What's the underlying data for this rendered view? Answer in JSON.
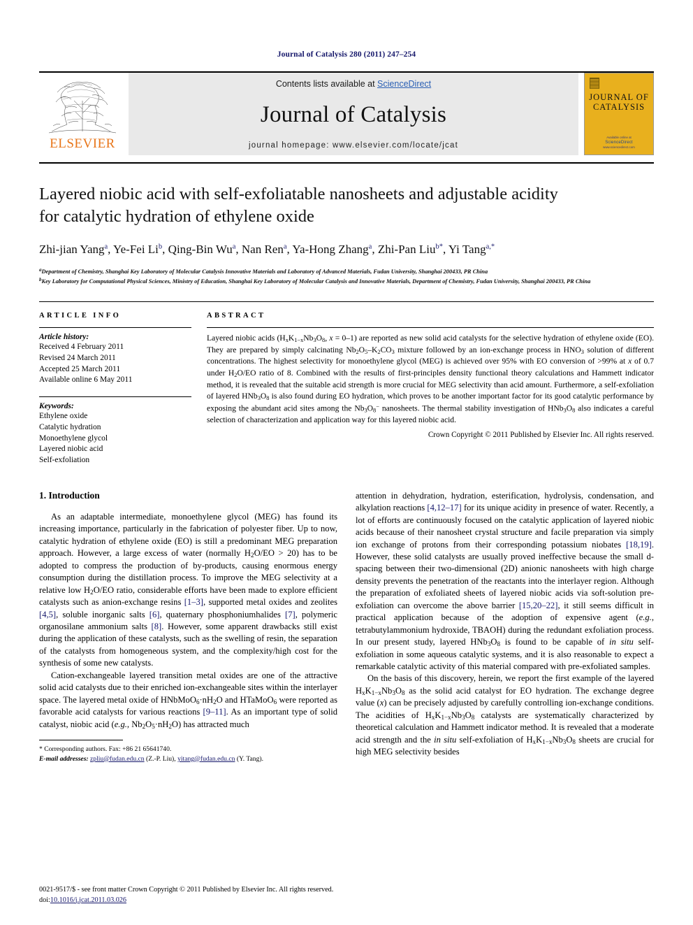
{
  "running_head": "Journal of Catalysis 280 (2011) 247–254",
  "masthead": {
    "elsevier_wordmark": "ELSEVIER",
    "contents_prefix": "Contents lists available at ",
    "sciencedirect": "ScienceDirect",
    "journal_name": "Journal of Catalysis",
    "homepage": "journal homepage: www.elsevier.com/locate/jcat",
    "cover_title": "JOURNAL OF CATALYSIS",
    "cover_note": "Available online at",
    "cover_sd": "ScienceDirect",
    "cover_url": "www.sciencedirect.com"
  },
  "article": {
    "title_line1": "Layered niobic acid with self-exfoliatable nanosheets and adjustable acidity",
    "title_line2": "for catalytic hydration of ethylene oxide",
    "authors": [
      {
        "name": "Zhi-jian Yang",
        "mark": "a"
      },
      {
        "name": "Ye-Fei Li",
        "mark": "b"
      },
      {
        "name": "Qing-Bin Wu",
        "mark": "a"
      },
      {
        "name": "Nan Ren",
        "mark": "a"
      },
      {
        "name": "Ya-Hong Zhang",
        "mark": "a"
      },
      {
        "name": "Zhi-Pan Liu",
        "mark": "b*"
      },
      {
        "name": "Yi Tang",
        "mark": "a,*"
      }
    ],
    "affiliation_a_mark": "a",
    "affiliation_a": "Department of Chemistry, Shanghai Key Laboratory of Molecular Catalysis Innovative Materials and Laboratory of Advanced Materials, Fudan University, Shanghai 200433, PR China",
    "affiliation_b_mark": "b",
    "affiliation_b": "Key Laboratory for Computational Physical Sciences, Ministry of Education, Shanghai Key Laboratory of Molecular Catalysis and Innovative Materials, Department of Chemistry, Fudan University, Shanghai 200433, PR China"
  },
  "article_info": {
    "heading": "ARTICLE INFO",
    "history_label": "Article history:",
    "history": [
      "Received 4 February 2011",
      "Revised 24 March 2011",
      "Accepted 25 March 2011",
      "Available online 6 May 2011"
    ],
    "keywords_label": "Keywords:",
    "keywords": [
      "Ethylene oxide",
      "Catalytic hydration",
      "Monoethylene glycol",
      "Layered niobic acid",
      "Self-exfoliation"
    ]
  },
  "abstract": {
    "heading": "ABSTRACT",
    "copyright": "Crown Copyright © 2011 Published by Elsevier Inc. All rights reserved."
  },
  "introduction": {
    "section_title": "1. Introduction"
  },
  "footnote": {
    "star": "*",
    "corresponding": "Corresponding authors. Fax: +86 21 65641740.",
    "email_label": "E-mail addresses:",
    "email1": "zpliu@fudan.edu.cn",
    "email1_owner": "(Z.-P. Liu),",
    "email2": "yitang@fudan.edu.cn",
    "email2_owner": "(Y. Tang)."
  },
  "footer": {
    "issn_line": "0021-9517/$ - see front matter Crown Copyright © 2011 Published by Elsevier Inc. All rights reserved.",
    "doi_label": "doi:",
    "doi": "10.1016/j.jcat.2011.03.026"
  },
  "colors": {
    "link_blue": "#2a5fb4",
    "ref_navy": "#16186b",
    "elsevier_orange": "#e8761a",
    "cover_yellow": "#e8b01e",
    "band_gray": "#e9e9e9"
  }
}
